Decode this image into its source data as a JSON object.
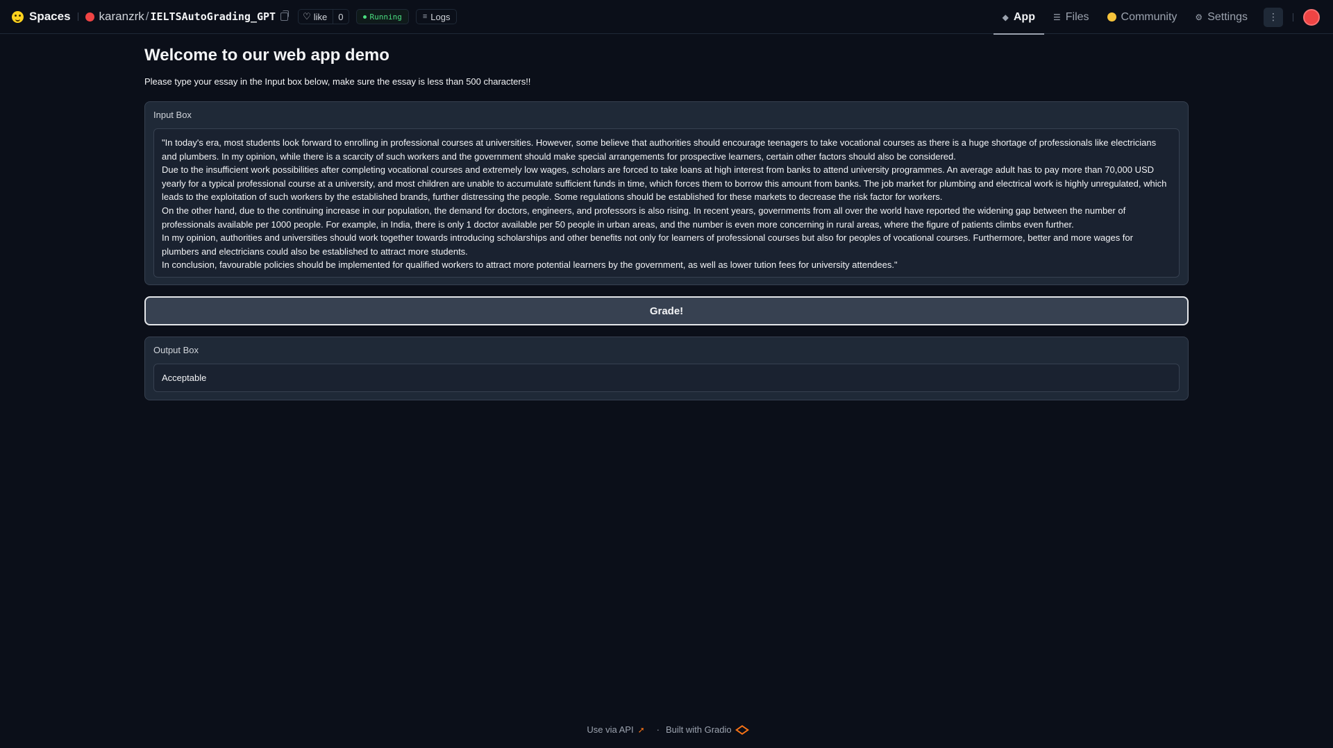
{
  "topbar": {
    "spaces_label": "Spaces",
    "owner": "karanzrk",
    "slash": "/",
    "repo": "IELTSAutoGrading_GPT",
    "like_label": "like",
    "like_count": "0",
    "status": "Running",
    "logs_label": "Logs",
    "tabs": [
      {
        "label": "App",
        "icon": "cube-icon",
        "active": true
      },
      {
        "label": "Files",
        "icon": "files-icon",
        "active": false
      },
      {
        "label": "Community",
        "icon": "community-icon",
        "active": false
      },
      {
        "label": "Settings",
        "icon": "gear-icon",
        "active": false
      }
    ]
  },
  "main": {
    "title": "Welcome to our web app demo",
    "subtitle": "Please type your essay in the Input box below, make sure the essay is less than 500 characters!!",
    "input_label": "Input Box",
    "essay": [
      "\"In today's era, most students look forward to enrolling in professional courses at universities. However, some believe that authorities should encourage teenagers to take vocational courses as there is a huge shortage of professionals like electricians and plumbers. In my opinion, while there is a scarcity of such workers and the government should make special arrangements for prospective learners, certain other factors should also be considered.",
      "Due to the insufficient work possibilities after completing vocational courses and extremely low wages, scholars are forced to take loans at high interest from banks to attend university programmes. An average adult has to pay more than 70,000 USD yearly for a typical professional course at a university, and most children are unable to accumulate sufficient funds in time, which forces them to borrow this amount from banks. The job market for plumbing and electrical work is highly unregulated, which leads to the exploitation of such workers by the established brands, further distressing the people. Some regulations should be established for these markets to decrease the risk factor for workers.",
      "On the other hand, due to the continuing increase in our population, the demand for doctors, engineers, and professors is also rising. In recent years, governments from all over the world have reported the widening gap between the number of professionals available per 1000 people. For example, in India, there is only 1 doctor available per 50 people in urban areas, and the number is even more concerning in rural areas, where the figure of patients climbs even further.",
      "In my opinion, authorities and universities should work together towards introducing scholarships and other benefits not only for learners of professional courses but also for peoples of vocational courses. Furthermore, better and more wages for plumbers and electricians could also be established to attract more students.",
      "In conclusion, favourable policies should be implemented for qualified workers to attract more potential learners by the government, as well as lower tution fees for university attendees.\""
    ],
    "grade_button": "Grade!",
    "output_label": "Output Box",
    "output_value": "Acceptable"
  },
  "footer": {
    "api_label": "Use via API",
    "separator": "·",
    "built_label": "Built with Gradio"
  },
  "colors": {
    "background": "#0b0f19",
    "panel": "#1f2937",
    "status_green": "#4ade80",
    "space_dot": "#ef4444",
    "accent_orange": "#f97316"
  }
}
